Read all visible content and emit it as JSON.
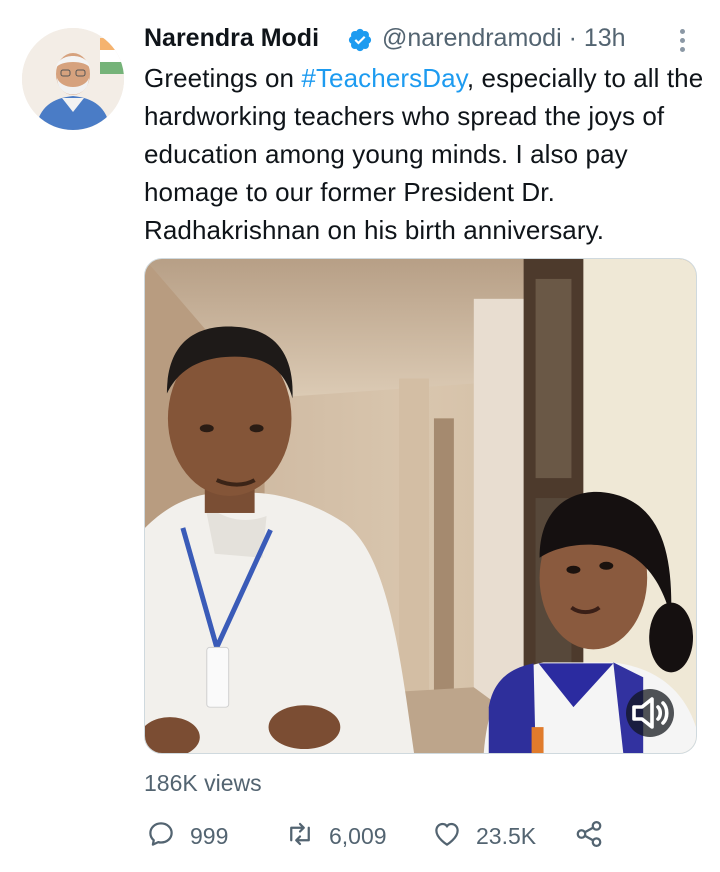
{
  "author": {
    "name": "Narendra Modi",
    "handle": "@narendramodi",
    "separator": "·",
    "time": "13h",
    "verified": true
  },
  "tweet": {
    "text_before_hashtag": "Greetings on ",
    "hashtag": "#TeachersDay",
    "text_after_hashtag": ", especially to all the hardworking teachers who spread the joys of education among young minds. I also pay homage to our former President Dr. Radhakrishnan on his birth anniversary."
  },
  "media": {
    "type": "video",
    "sound_button_icon": "speaker-muted-icon"
  },
  "stats": {
    "views": "186K views"
  },
  "actions": {
    "reply_count": "999",
    "retweet_count": "6,009",
    "like_count": "23.5K"
  },
  "colors": {
    "text": "#0f1419",
    "secondary": "#536471",
    "accent": "#1d9bf0"
  },
  "icons": [
    "verified-badge-icon",
    "more-options-icon",
    "reply-icon",
    "retweet-icon",
    "like-icon",
    "share-icon",
    "speaker-muted-icon"
  ]
}
